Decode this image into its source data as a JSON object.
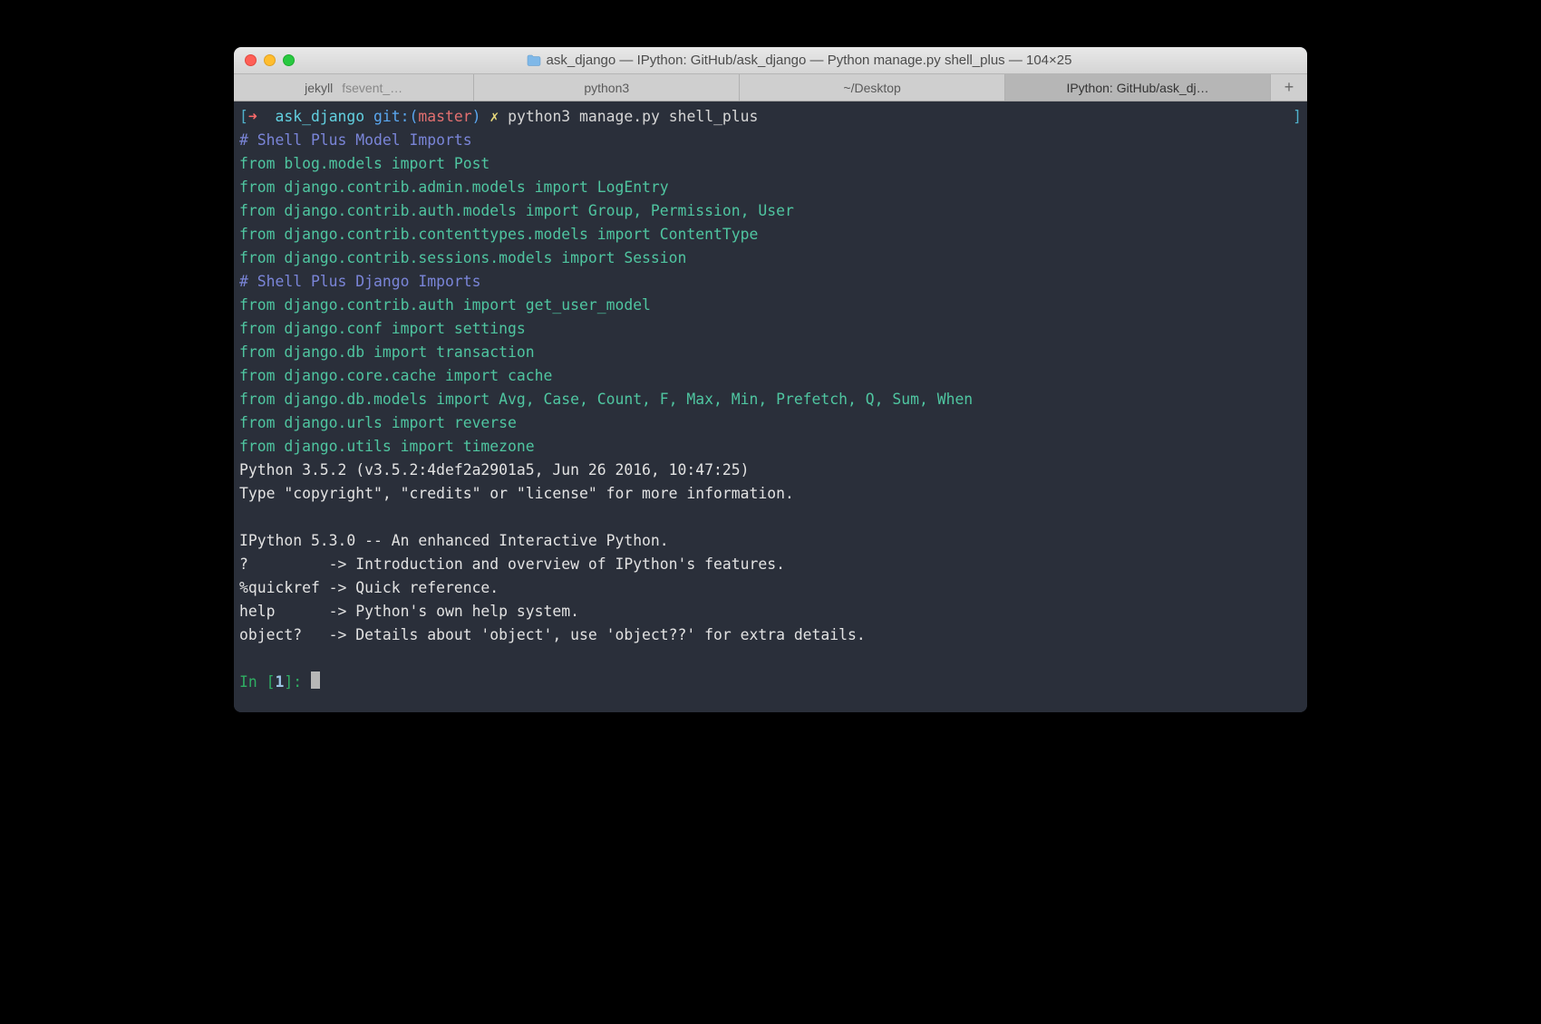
{
  "window": {
    "title": "ask_django — IPython: GitHub/ask_django — Python manage.py shell_plus — 104×25"
  },
  "tabs": {
    "compound_a": "jekyll",
    "compound_b": "fsevent_…",
    "t1": "python3",
    "t2": "~/Desktop",
    "active": "IPython: GitHub/ask_dj…",
    "add": "+"
  },
  "prompt": {
    "lbracket": "[",
    "arrow": "➜  ",
    "dir": "ask_django",
    "git_label": " git:(",
    "branch": "master",
    "git_close": ") ",
    "dirty": "✗",
    "cmd": " python3 manage.py shell_plus",
    "rbracket": "]"
  },
  "lines": {
    "c1": "# Shell Plus Model Imports",
    "i1": "from blog.models import Post",
    "i2": "from django.contrib.admin.models import LogEntry",
    "i3": "from django.contrib.auth.models import Group, Permission, User",
    "i4": "from django.contrib.contenttypes.models import ContentType",
    "i5": "from django.contrib.sessions.models import Session",
    "c2": "# Shell Plus Django Imports",
    "i6": "from django.contrib.auth import get_user_model",
    "i7": "from django.conf import settings",
    "i8": "from django.db import transaction",
    "i9": "from django.core.cache import cache",
    "i10": "from django.db.models import Avg, Case, Count, F, Max, Min, Prefetch, Q, Sum, When",
    "i11": "from django.urls import reverse",
    "i12": "from django.utils import timezone",
    "p1": "Python 3.5.2 (v3.5.2:4def2a2901a5, Jun 26 2016, 10:47:25)",
    "p2": "Type \"copyright\", \"credits\" or \"license\" for more information.",
    "p3": "",
    "p4": "IPython 5.3.0 -- An enhanced Interactive Python.",
    "p5": "?         -> Introduction and overview of IPython's features.",
    "p6": "%quickref -> Quick reference.",
    "p7": "help      -> Python's own help system.",
    "p8": "object?   -> Details about 'object', use 'object??' for extra details."
  },
  "inprompt": {
    "pre": "In [",
    "num": "1",
    "post": "]: "
  }
}
